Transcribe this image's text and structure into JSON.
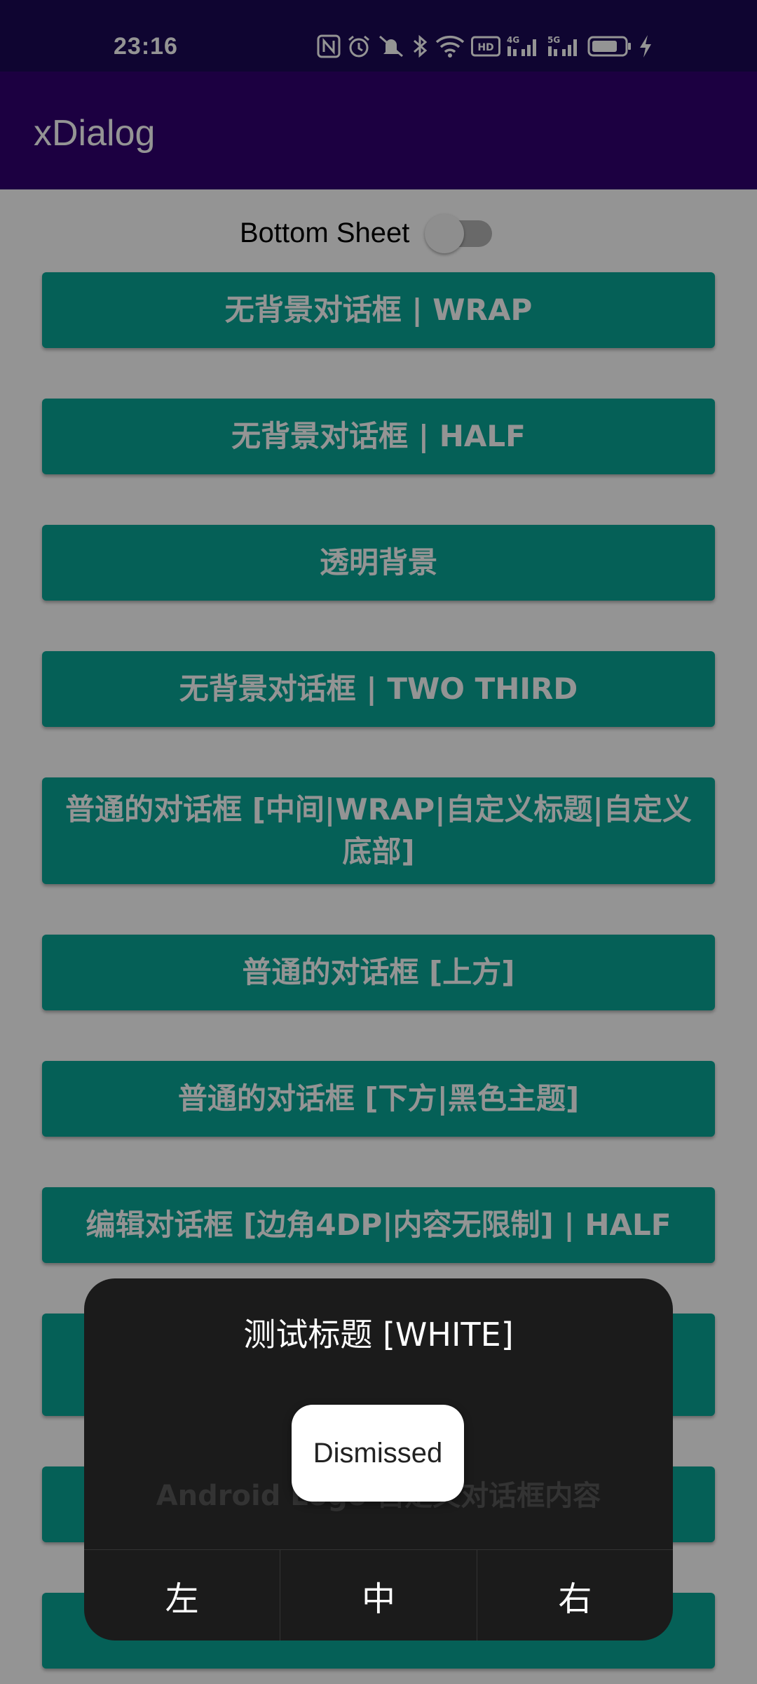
{
  "status_bar": {
    "time": "23:16",
    "icons": [
      "nfc-icon",
      "alarm-icon",
      "mute-icon",
      "bluetooth-icon",
      "wifi-icon",
      "hd-icon",
      "signal-4g-icon",
      "signal-5g-icon",
      "battery-icon",
      "charging-icon"
    ],
    "battery_level": 0.8
  },
  "app_bar": {
    "title": "xDialog"
  },
  "bottom_sheet_switch": {
    "label": "Bottom Sheet",
    "checked": false
  },
  "buttons": [
    "无背景对话框 | WRAP",
    "无背景对话框 | HALF",
    "透明背景",
    "无背景对话框 | TWO THIRD",
    "普通的对话框 [中间|WRAP|自定义标题|自定义底部]",
    "普通的对话框 [上方]",
    "普通的对话框 [下方|黑色主题]",
    "编辑对话框 [边角4DP|内容无限制] | HALF",
    "",
    "",
    ""
  ],
  "dialog": {
    "title": "测试标题 [WHITE]",
    "content": "Android Logo 自定义对话框内容",
    "buttons": [
      "左",
      "中",
      "右"
    ]
  },
  "toast": {
    "text": "Dismissed"
  },
  "colors": {
    "status_bar": "#1a0a55",
    "app_bar": "#310070",
    "button": "#0aa596",
    "dialog_bg": "#1b1b1b",
    "scrim": "rgba(0,0,0,0.42)"
  }
}
